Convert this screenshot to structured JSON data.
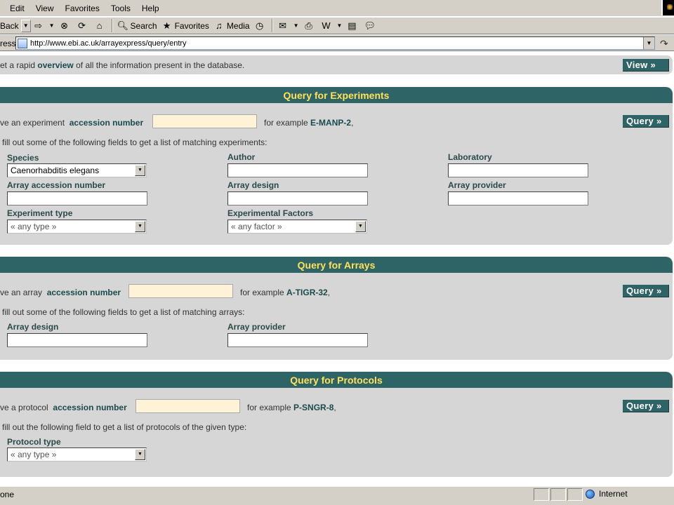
{
  "menu": [
    "Edit",
    "View",
    "Favorites",
    "Tools",
    "Help"
  ],
  "toolbar": {
    "back": "Back",
    "search": "Search",
    "favorites": "Favorites",
    "media": "Media"
  },
  "address": {
    "label": "ress",
    "url": "http://www.ebi.ac.uk/arrayexpress/query/entry"
  },
  "overview": {
    "pre": "et a rapid",
    "bold": "overview",
    "post": "of all the information present in the database.",
    "button": "View »"
  },
  "experiments": {
    "title": "Query for Experiments",
    "acc_pre": "ve an experiment",
    "acc_bold": "accession number",
    "example_pre": "for example",
    "example_value": "E-MANP-2",
    "example_post": ",",
    "query_button": "Query »",
    "fill_text": "fill out some of the following fields to get a list of matching experiments:",
    "fields": {
      "species_label": "Species",
      "species_value": "Caenorhabditis elegans",
      "author_label": "Author",
      "laboratory_label": "Laboratory",
      "array_accession_label": "Array accession number",
      "array_design_label": "Array design",
      "array_provider_label": "Array provider",
      "experiment_type_label": "Experiment type",
      "experiment_type_value": "« any type »",
      "experimental_factors_label": "Experimental Factors",
      "experimental_factors_value": "« any factor »"
    }
  },
  "arrays": {
    "title": "Query for Arrays",
    "acc_pre": "ve an array",
    "acc_bold": "accession number",
    "example_pre": "for example",
    "example_value": "A-TIGR-32",
    "example_post": ",",
    "query_button": "Query »",
    "fill_text": "fill out some of the following fields to get a list of matching arrays:",
    "fields": {
      "array_design_label": "Array design",
      "array_provider_label": "Array provider"
    }
  },
  "protocols": {
    "title": "Query for Protocols",
    "acc_pre": "ve a protocol",
    "acc_bold": "accession number",
    "example_pre": "for example",
    "example_value": "P-SNGR-8",
    "example_post": ",",
    "query_button": "Query »",
    "fill_text": "fill out the following field to get a list of protocols of the given type:",
    "fields": {
      "protocol_type_label": "Protocol type",
      "protocol_type_value": "« any type »"
    }
  },
  "status": {
    "text": "one",
    "zone": "Internet"
  },
  "colors": {
    "header_bg": "#2f6466",
    "header_text": "#ffe25a",
    "panel_bg": "#d6d6d6",
    "accession_input_bg": "#fef3d6"
  }
}
